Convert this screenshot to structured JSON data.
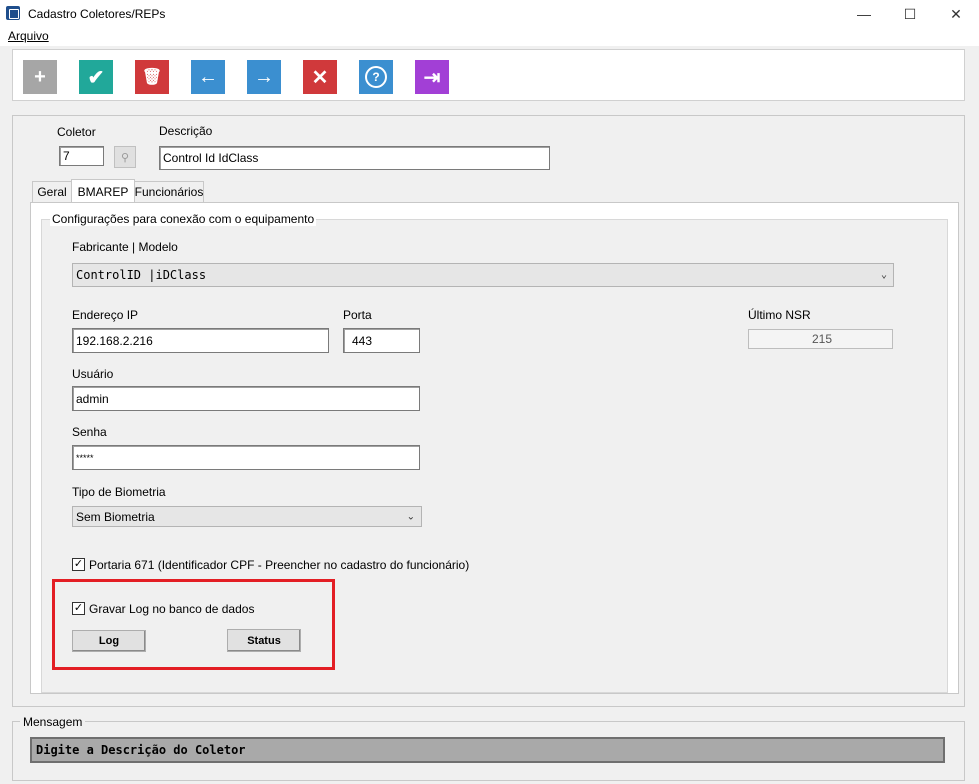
{
  "window": {
    "title": "Cadastro Coletores/REPs",
    "controls": [
      "minimize-icon",
      "maximize-icon",
      "close-icon"
    ]
  },
  "menu": {
    "items": [
      {
        "label": "Arquivo"
      }
    ]
  },
  "toolbar": {
    "buttons": [
      {
        "name": "add",
        "icon": "plus-icon",
        "color": "#a6a6a6",
        "glyph": "+"
      },
      {
        "name": "save",
        "icon": "check-icon",
        "color": "#21a89a",
        "glyph": "✔"
      },
      {
        "name": "delete",
        "icon": "trash-icon",
        "color": "#d0393b",
        "glyph": "🗑"
      },
      {
        "name": "previous",
        "icon": "arrow-left-icon",
        "color": "#3b8fd0",
        "glyph": "←"
      },
      {
        "name": "next",
        "icon": "arrow-right-icon",
        "color": "#3b8fd0",
        "glyph": "→"
      },
      {
        "name": "cancel",
        "icon": "x-icon",
        "color": "#d0393b",
        "glyph": "✕"
      },
      {
        "name": "help",
        "icon": "question-icon",
        "color": "#3b8fd0",
        "glyph": "?"
      },
      {
        "name": "exit",
        "icon": "exit-icon",
        "color": "#a23fd6",
        "glyph": "⇥"
      }
    ]
  },
  "form": {
    "coletor_label": "Coletor",
    "coletor_value": "7",
    "descricao_label": "Descrição",
    "descricao_value": "Control Id IdClass"
  },
  "tabs": [
    {
      "label": "Geral",
      "active": false
    },
    {
      "label": "BMAREP",
      "active": true
    },
    {
      "label": "Funcionários",
      "active": false
    }
  ],
  "bmarep": {
    "group_title": "Configurações para conexão com o equipamento",
    "fabricante_label": "Fabricante | Modelo",
    "fabricante_value": "ControlID |iDClass",
    "ip_label": "Endereço IP",
    "ip_value": "192.168.2.216",
    "porta_label": "Porta",
    "porta_value": "443",
    "nsr_label": "Último NSR",
    "nsr_value": "215",
    "usuario_label": "Usuário",
    "usuario_value": "admin",
    "senha_label": "Senha",
    "senha_value": "*****",
    "biometria_label": "Tipo de Biometria",
    "biometria_value": "Sem Biometria",
    "portaria_label": "Portaria 671 (Identificador CPF - Preencher no cadastro do funcionário)",
    "portaria_checked": true,
    "gravar_log_label": "Gravar Log no banco de dados",
    "gravar_log_checked": true,
    "log_button": "Log",
    "status_button": "Status"
  },
  "mensagem": {
    "title": "Mensagem",
    "text": "Digite a Descrição do Coletor"
  },
  "colors": {
    "highlight": "#e31e24"
  }
}
